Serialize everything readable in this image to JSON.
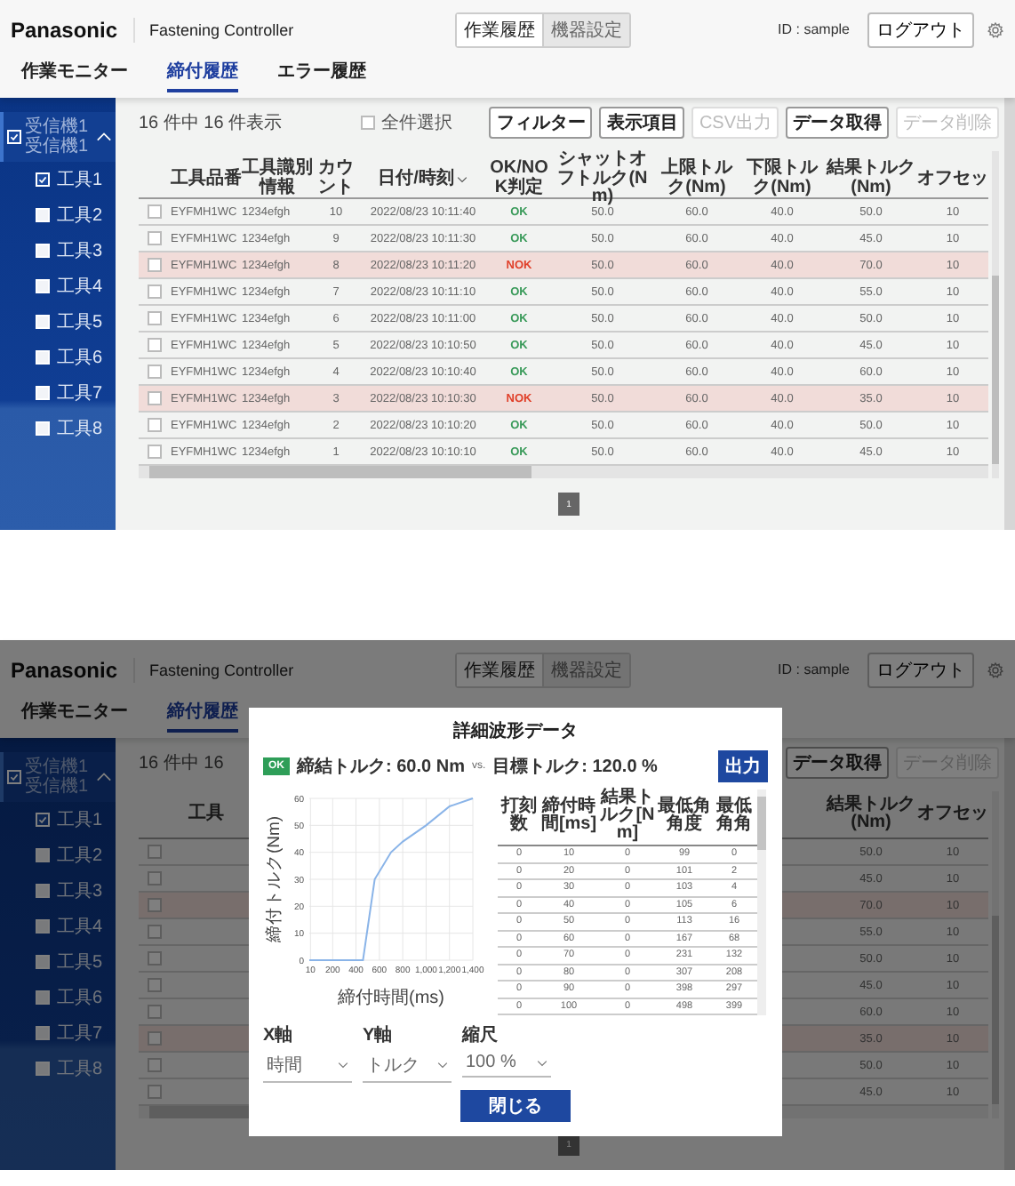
{
  "main_screen": {
    "header": {
      "logo": "Panasonic",
      "title": "Fastening Controller",
      "modes": [
        {
          "label": "作業履歴",
          "selected": true
        },
        {
          "label": "機器設定",
          "selected": false
        }
      ],
      "user": "ID : sample",
      "logout": "ログアウト"
    },
    "tabs": [
      {
        "label": "作業モニター",
        "selected": false
      },
      {
        "label": "締付履歴",
        "selected": true
      },
      {
        "label": "エラー履歴",
        "selected": false
      }
    ],
    "sidebar": {
      "group": {
        "lines": [
          "受信機1",
          "受信機1"
        ],
        "checked": true,
        "expanded": true
      },
      "tools": [
        {
          "label": "工具1",
          "checked": true
        },
        {
          "label": "工具2",
          "checked": false
        },
        {
          "label": "工具3",
          "checked": false
        },
        {
          "label": "工具4",
          "checked": false
        },
        {
          "label": "工具5",
          "checked": false
        },
        {
          "label": "工具6",
          "checked": false
        },
        {
          "label": "工具7",
          "checked": false
        },
        {
          "label": "工具8",
          "checked": false
        }
      ]
    },
    "toolbar": {
      "count": "16 件中 16 件表示",
      "select_all": {
        "label": "全件選択",
        "checked": false
      },
      "buttons": [
        {
          "label": "フィルター",
          "disabled": false
        },
        {
          "label": "表示項目",
          "disabled": false
        },
        {
          "label": "CSV出力",
          "disabled": true
        },
        {
          "label": "データ取得",
          "disabled": false
        },
        {
          "label": "データ削除",
          "disabled": true
        }
      ]
    },
    "table": {
      "columns": [
        {
          "label": "工具品番"
        },
        {
          "label": "工具識別情報"
        },
        {
          "label": "カウント"
        },
        {
          "label": "日付/時刻",
          "sorted": true
        },
        {
          "label": "OK/NOK判定"
        },
        {
          "label": "シャットオフトルク(Nm)"
        },
        {
          "label": "上限トルク(Nm)"
        },
        {
          "label": "下限トルク(Nm)"
        },
        {
          "label": "結果トルク(Nm)"
        },
        {
          "label": "オフセッ"
        }
      ],
      "rows": [
        {
          "checked": false,
          "failed": false,
          "cells": [
            "EYFMH1WC",
            "1234efgh",
            "10",
            "2022/08/23 10:11:40",
            "OK",
            "50.0",
            "60.0",
            "40.0",
            "50.0",
            "10"
          ]
        },
        {
          "checked": false,
          "failed": false,
          "cells": [
            "EYFMH1WC",
            "1234efgh",
            "9",
            "2022/08/23 10:11:30",
            "OK",
            "50.0",
            "60.0",
            "40.0",
            "45.0",
            "10"
          ]
        },
        {
          "checked": false,
          "failed": true,
          "cells": [
            "EYFMH1WC",
            "1234efgh",
            "8",
            "2022/08/23 10:11:20",
            "NOK",
            "50.0",
            "60.0",
            "40.0",
            "70.0",
            "10"
          ]
        },
        {
          "checked": false,
          "failed": false,
          "cells": [
            "EYFMH1WC",
            "1234efgh",
            "7",
            "2022/08/23 10:11:10",
            "OK",
            "50.0",
            "60.0",
            "40.0",
            "55.0",
            "10"
          ]
        },
        {
          "checked": false,
          "failed": false,
          "cells": [
            "EYFMH1WC",
            "1234efgh",
            "6",
            "2022/08/23 10:11:00",
            "OK",
            "50.0",
            "60.0",
            "40.0",
            "50.0",
            "10"
          ]
        },
        {
          "checked": false,
          "failed": false,
          "cells": [
            "EYFMH1WC",
            "1234efgh",
            "5",
            "2022/08/23 10:10:50",
            "OK",
            "50.0",
            "60.0",
            "40.0",
            "45.0",
            "10"
          ]
        },
        {
          "checked": false,
          "failed": false,
          "cells": [
            "EYFMH1WC",
            "1234efgh",
            "4",
            "2022/08/23 10:10:40",
            "OK",
            "50.0",
            "60.0",
            "40.0",
            "60.0",
            "10"
          ]
        },
        {
          "checked": false,
          "failed": true,
          "cells": [
            "EYFMH1WC",
            "1234efgh",
            "3",
            "2022/08/23 10:10:30",
            "NOK",
            "50.0",
            "60.0",
            "40.0",
            "35.0",
            "10"
          ]
        },
        {
          "checked": false,
          "failed": false,
          "cells": [
            "EYFMH1WC",
            "1234efgh",
            "2",
            "2022/08/23 10:10:20",
            "OK",
            "50.0",
            "60.0",
            "40.0",
            "50.0",
            "10"
          ]
        },
        {
          "checked": false,
          "failed": false,
          "cells": [
            "EYFMH1WC",
            "1234efgh",
            "1",
            "2022/08/23 10:10:10",
            "OK",
            "50.0",
            "60.0",
            "40.0",
            "45.0",
            "10"
          ]
        }
      ]
    },
    "pagination": [
      {
        "label": "1",
        "selected": true
      }
    ]
  },
  "detail_screen": {
    "header": {
      "logo": "Panasonic",
      "title": "Fastening Controller",
      "modes": [
        {
          "label": "作業履歴",
          "selected": true
        },
        {
          "label": "機器設定",
          "selected": false
        }
      ],
      "user": "ID : sample",
      "logout": "ログアウト"
    },
    "tabs": [
      {
        "label": "作業モニター",
        "selected": false
      },
      {
        "label": "締付履歴",
        "selected": true
      }
    ],
    "sidebar": {
      "group": {
        "lines": [
          "受信機1",
          "受信機1"
        ],
        "checked": true,
        "expanded": true
      },
      "tools": [
        {
          "label": "工具1",
          "checked": true
        },
        {
          "label": "工具2",
          "checked": false
        },
        {
          "label": "工具3",
          "checked": false
        },
        {
          "label": "工具4",
          "checked": false
        },
        {
          "label": "工具5",
          "checked": false
        },
        {
          "label": "工具6",
          "checked": false
        },
        {
          "label": "工具7",
          "checked": false
        },
        {
          "label": "工具8",
          "checked": false
        }
      ]
    },
    "toolbar": {
      "count": "16 件中 16",
      "buttons": [
        {
          "label": "データ取得",
          "disabled": false
        },
        {
          "label": "データ削除",
          "disabled": true
        }
      ]
    },
    "table": {
      "left_columns": [
        {
          "label": "工具"
        }
      ],
      "right_columns": [
        {
          "label": "結果トルク(Nm)"
        },
        {
          "label": "オフセッ"
        }
      ],
      "rows": [
        {
          "checked": false,
          "failed": false,
          "cells": [
            "50.0",
            "10"
          ]
        },
        {
          "checked": false,
          "failed": false,
          "cells": [
            "45.0",
            "10"
          ]
        },
        {
          "checked": false,
          "failed": true,
          "cells": [
            "70.0",
            "10"
          ]
        },
        {
          "checked": false,
          "failed": false,
          "cells": [
            "55.0",
            "10"
          ]
        },
        {
          "checked": false,
          "failed": false,
          "cells": [
            "50.0",
            "10"
          ]
        },
        {
          "checked": false,
          "failed": false,
          "cells": [
            "45.0",
            "10"
          ]
        },
        {
          "checked": false,
          "failed": false,
          "cells": [
            "60.0",
            "10"
          ]
        },
        {
          "checked": false,
          "failed": true,
          "cells": [
            "35.0",
            "10"
          ]
        },
        {
          "checked": false,
          "failed": false,
          "cells": [
            "50.0",
            "10"
          ]
        },
        {
          "checked": false,
          "failed": false,
          "cells": [
            "45.0",
            "10"
          ]
        }
      ]
    },
    "pagination": [
      {
        "label": "1",
        "selected": true
      }
    ],
    "dialog": {
      "title": "詳細波形データ",
      "judgement": "OK",
      "failed": false,
      "result_torque": "締結トルク: 60.0 Nm",
      "versus": "vs.",
      "target_torque": "目標トルク: 120.0 %",
      "export": "出力",
      "chart_data": {
        "type": "line",
        "xlabel": "締付時間(ms)",
        "ylabel": "締付トルク(Nm)",
        "x": [
          0,
          460,
          560,
          700,
          800,
          1000,
          1200,
          1400
        ],
        "grid": true,
        "series": [
          {
            "color": "#8ab4e8",
            "values": [
              0,
              0,
              30,
              40,
              44,
              50,
              57,
              60
            ]
          }
        ],
        "xlim": [
          0,
          1400
        ],
        "ylim": [
          0,
          60
        ],
        "xticks": [
          10,
          200,
          400,
          600,
          800,
          {
            "value": 1000,
            "label": "1,000"
          },
          {
            "value": 1200,
            "label": "1,200"
          },
          {
            "value": 1400,
            "label": "1,400"
          }
        ],
        "yticks": [
          0,
          10,
          20,
          30,
          40,
          50,
          60
        ]
      },
      "table": {
        "columns": [
          "打刻数",
          "締付時間[ms]",
          "結果トルク[Nm]",
          "最低角角度",
          "最低角角"
        ],
        "rows": [
          [
            "0",
            "10",
            "0",
            "99",
            "0"
          ],
          [
            "0",
            "20",
            "0",
            "101",
            "2"
          ],
          [
            "0",
            "30",
            "0",
            "103",
            "4"
          ],
          [
            "0",
            "40",
            "0",
            "105",
            "6"
          ],
          [
            "0",
            "50",
            "0",
            "113",
            "16"
          ],
          [
            "0",
            "60",
            "0",
            "167",
            "68"
          ],
          [
            "0",
            "70",
            "0",
            "231",
            "132"
          ],
          [
            "0",
            "80",
            "0",
            "307",
            "208"
          ],
          [
            "0",
            "90",
            "0",
            "398",
            "297"
          ],
          [
            "0",
            "100",
            "0",
            "498",
            "399"
          ]
        ]
      },
      "selects": [
        {
          "label": "X軸",
          "value": "時間"
        },
        {
          "label": "Y軸",
          "value": "トルク"
        },
        {
          "label": "縮尺",
          "value": "100 %"
        }
      ],
      "close": "閉じる"
    }
  }
}
